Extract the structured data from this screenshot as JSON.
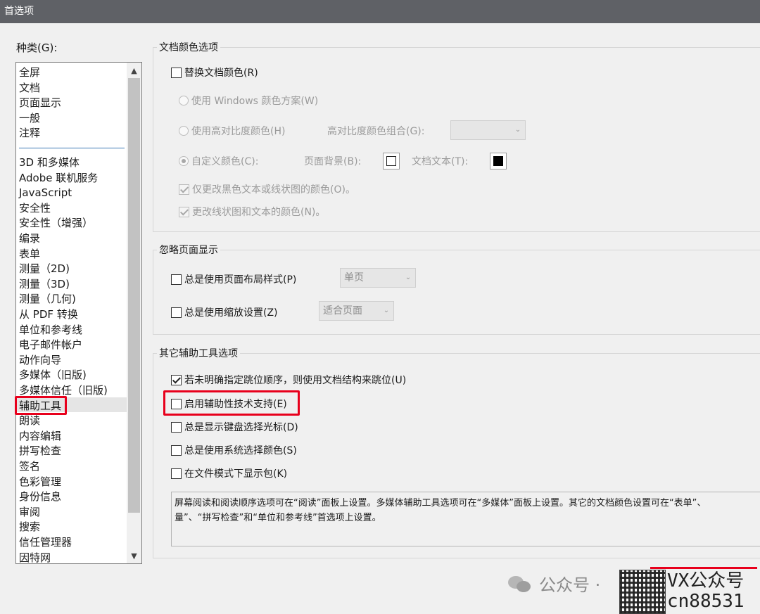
{
  "window": {
    "title": "首选项"
  },
  "categories": {
    "label": "种类(G):",
    "items": [
      "全屏",
      "文档",
      "页面显示",
      "一般",
      "注释",
      "3D 和多媒体",
      "Adobe 联机服务",
      "JavaScript",
      "安全性",
      "安全性（增强）",
      "编录",
      "表单",
      "测量（2D)",
      "测量（3D)",
      "测量（几何)",
      "从 PDF 转换",
      "单位和参考线",
      "电子邮件帐户",
      "动作向导",
      "多媒体（旧版)",
      "多媒体信任（旧版)",
      "辅助工具",
      "朗读",
      "内容编辑",
      "拼写检查",
      "签名",
      "色彩管理",
      "身份信息",
      "审阅",
      "搜索",
      "信任管理器",
      "因特网"
    ],
    "selected": "辅助工具",
    "scroll_up_icon": "chevron-up-icon",
    "scroll_down_icon": "chevron-down-icon"
  },
  "doc_colors": {
    "title": "文档颜色选项",
    "replace_colors": "替换文档颜色(R)",
    "use_windows": "使用 Windows 颜色方案(W)",
    "use_high_contrast": "使用高对比度颜色(H)",
    "high_contrast_combo_label": "高对比度颜色组合(G):",
    "high_contrast_combo_value": "",
    "custom_color": "自定义颜色(C):",
    "page_bg_label": "页面背景(B):",
    "doc_text_label": "文档文本(T):",
    "page_bg_color": "#ffffff",
    "doc_text_color": "#000000",
    "only_black_text": "仅更改黑色文本或线状图的颜色(O)。",
    "change_line_text": "更改线状图和文本的颜色(N)。"
  },
  "override": {
    "title": "忽略页面显示",
    "always_page_layout": "总是使用页面布局样式(P)",
    "page_layout_value": "单页",
    "always_zoom": "总是使用缩放设置(Z)",
    "zoom_value": "适合页面"
  },
  "other_tools": {
    "title": "其它辅助工具选项",
    "options": [
      {
        "label": "若未明确指定跳位顺序，则使用文档结构来跳位(U)",
        "checked": true
      },
      {
        "label": "启用辅助性技术支持(E)",
        "checked": false
      },
      {
        "label": "总是显示键盘选择光标(D)",
        "checked": false
      },
      {
        "label": "总是使用系统选择颜色(S)",
        "checked": false
      },
      {
        "label": "在文件模式下显示包(K)",
        "checked": false
      }
    ],
    "info_line1": "屏幕阅读和阅读顺序选项可在“阅读”面板上设置。多媒体辅助工具选项可在“多媒体”面板上设置。其它的文档颜色设置可在“表单”、",
    "info_line2": "量”、“拼写检查”和“单位和参考线”首选项上设置。"
  },
  "watermark": {
    "text": "公众号 ·",
    "icon": "wechat-icon",
    "vx_line1": "VX公众号",
    "vx_line2": "cn88531"
  },
  "highlight_color": "#e8001c"
}
